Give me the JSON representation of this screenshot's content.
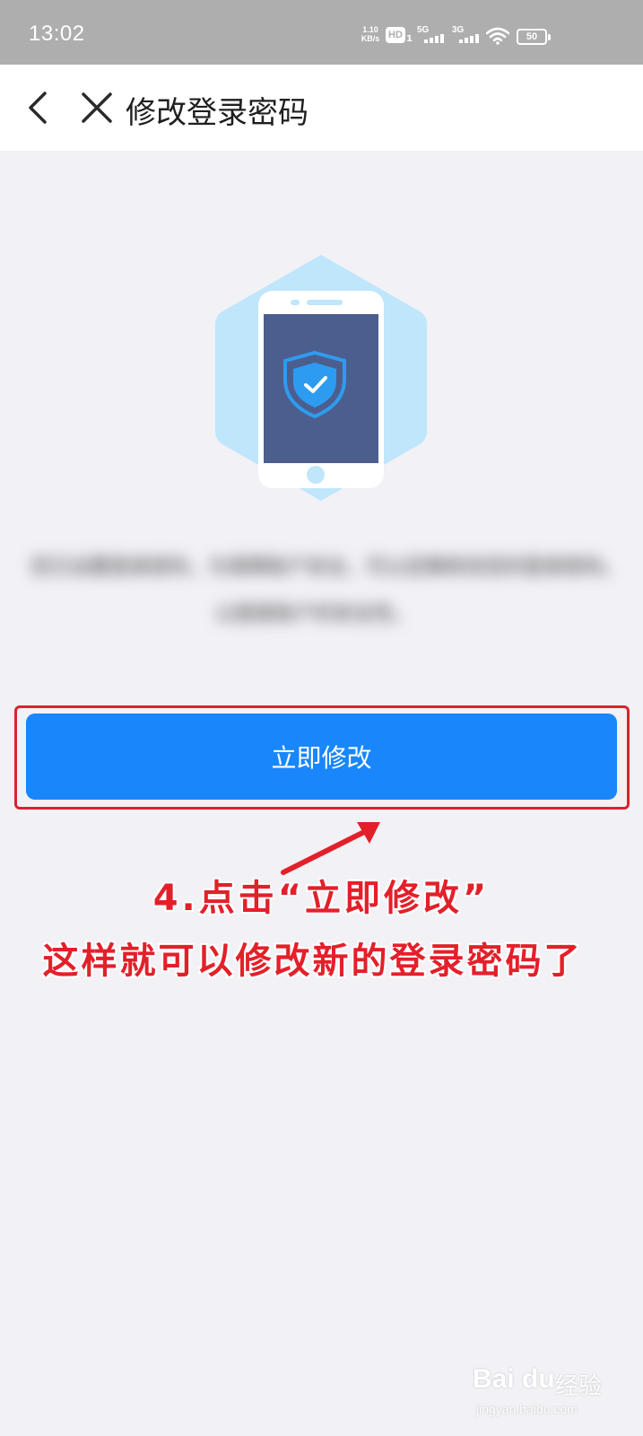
{
  "status_bar": {
    "time": "13:02",
    "net_speed_value": "1.10",
    "net_speed_unit": "KB/s",
    "hd_label": "HD",
    "hd_sub": "1",
    "signal_1_label": "5G",
    "signal_2_label": "3G",
    "battery": "50"
  },
  "nav": {
    "title": "修改登录密码",
    "back_icon": "chevron-left-icon",
    "close_icon": "close-icon"
  },
  "hero": {
    "icon": "phone-shield-check-icon"
  },
  "description": {
    "line_1": "您已设置登录密码，为保障账户安全，可以定期修改您的登录密码。",
    "line_2": "以提高账户的安全性。"
  },
  "primary_button": {
    "label": "立即修改"
  },
  "annotation": {
    "line_1": "4.点击“立即修改”",
    "line_2": "这样就可以修改新的登录密码了"
  },
  "watermark": {
    "logo": "Bai du",
    "text": "经验",
    "url": "jingyan.baidu.com"
  },
  "colors": {
    "status_bar": "#aeaeae",
    "page_background": "#f1f1f6",
    "primary": "#1a86fb",
    "annotation_red": "#e3202a",
    "hero_hexagon": "#bfe6fb",
    "phone_screen": "#4c5e8e"
  }
}
